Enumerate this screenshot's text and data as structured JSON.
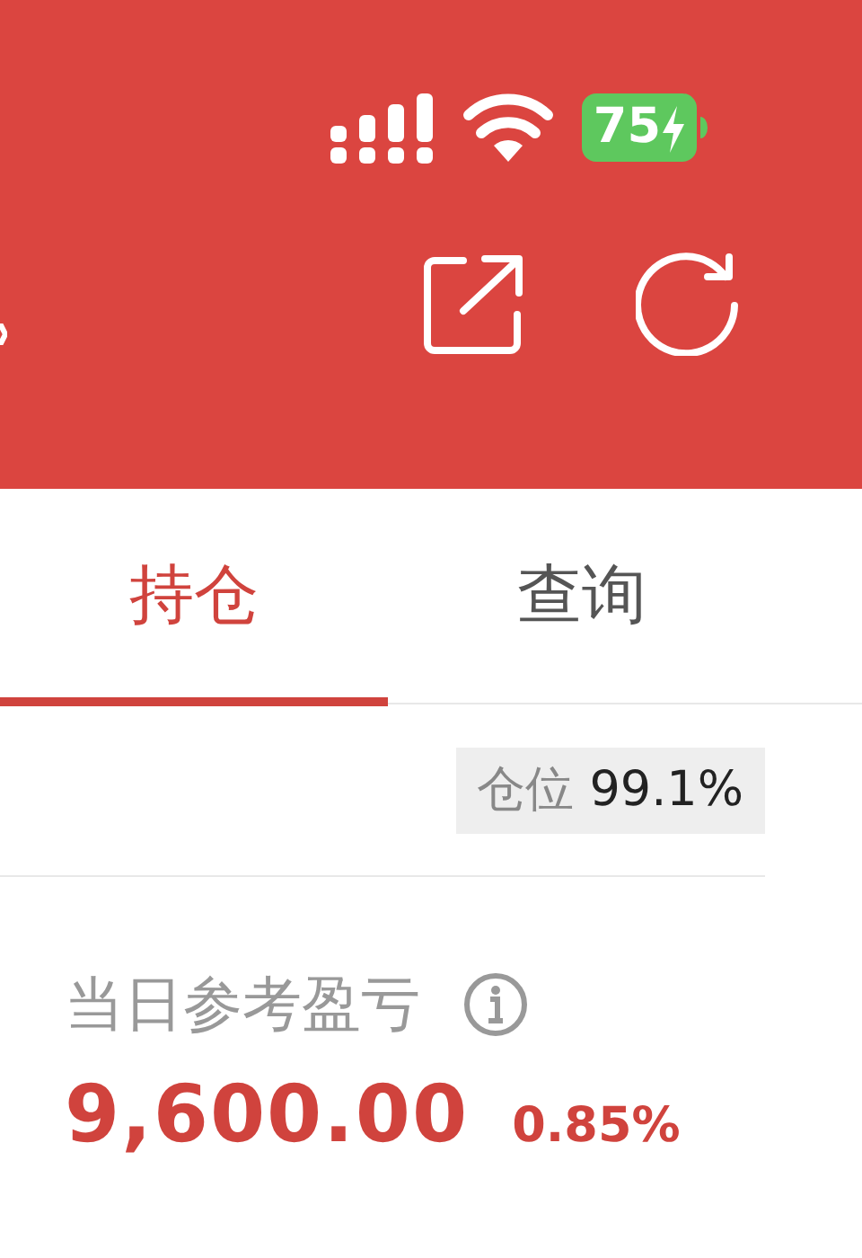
{
  "status_bar": {
    "battery": "75",
    "charging": true
  },
  "tabs": [
    {
      "label": "持仓",
      "selected": true
    },
    {
      "label": "查询",
      "selected": false
    }
  ],
  "position": {
    "label": "仓位",
    "value": "99.1%"
  },
  "daily_pnl": {
    "label": "当日参考盈亏",
    "value": "9,600.00",
    "percent": "0.85%"
  }
}
